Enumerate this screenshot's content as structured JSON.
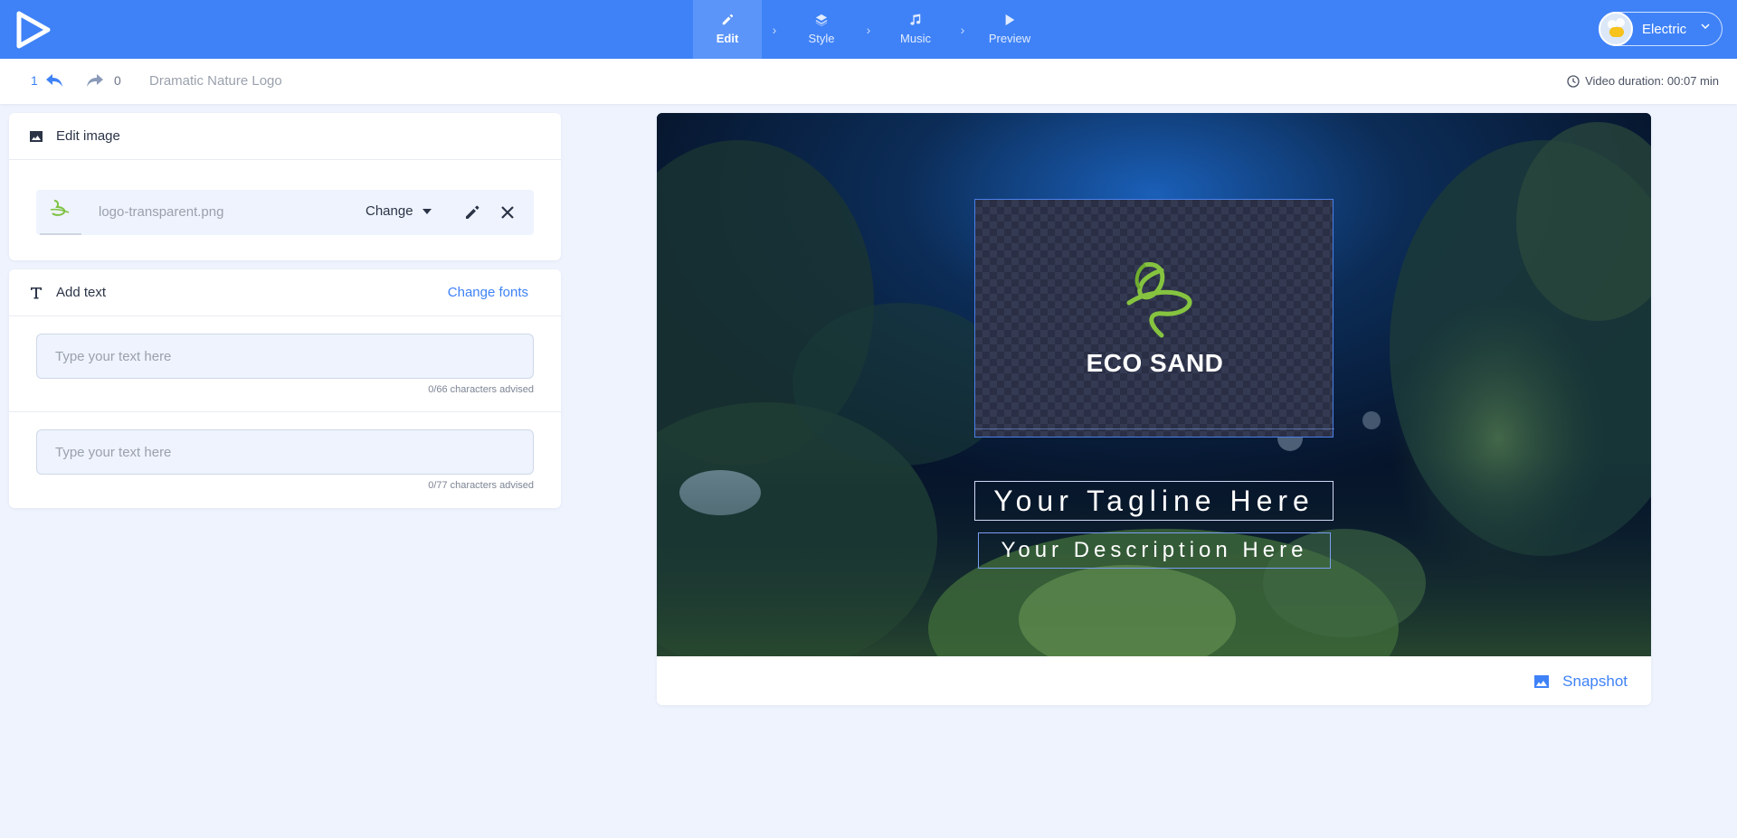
{
  "header": {
    "steps": [
      {
        "label": "Edit",
        "icon": "pencil-icon",
        "active": true
      },
      {
        "label": "Style",
        "icon": "layers-icon",
        "active": false
      },
      {
        "label": "Music",
        "icon": "music-note-icon",
        "active": false
      },
      {
        "label": "Preview",
        "icon": "play-icon",
        "active": false
      }
    ],
    "account": {
      "name": "Electric",
      "avatar": "bee-avatar"
    },
    "accent_color": "#3f82f7"
  },
  "subbar": {
    "undo_count": "1",
    "redo_count": "0",
    "project_name": "Dramatic Nature Logo",
    "duration": "Video duration: 00:07 min"
  },
  "edit_image": {
    "title": "Edit image",
    "filename": "logo-transparent.png",
    "change_label": "Change"
  },
  "add_text": {
    "title": "Add text",
    "change_fonts": "Change fonts",
    "fields": [
      {
        "placeholder": "Type your text here",
        "value": "",
        "hint": "0/66 characters advised"
      },
      {
        "placeholder": "Type your text here",
        "value": "",
        "hint": "0/77 characters advised"
      }
    ]
  },
  "preview": {
    "logo_text": "ECO SAND",
    "tagline": "Your Tagline Here",
    "description": "Your Description Here",
    "snapshot_label": "Snapshot"
  }
}
